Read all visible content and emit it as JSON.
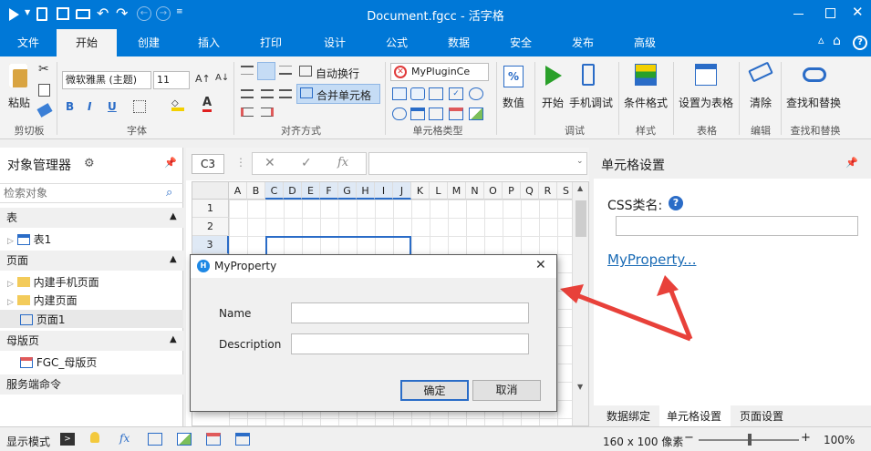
{
  "window": {
    "title": "Document.fgcc - 活字格"
  },
  "tabs": [
    "文件",
    "开始",
    "创建",
    "插入",
    "打印",
    "设计",
    "公式",
    "数据",
    "安全",
    "发布",
    "高级"
  ],
  "ribbon": {
    "paste": "粘贴",
    "clipboard": "剪切板",
    "font_name": "微软雅黑 (主题)",
    "font_size": "11",
    "bold": "B",
    "italic": "I",
    "underline": "U",
    "font_color_letter": "A",
    "font_group": "字体",
    "wrap_text": "自动换行",
    "merge_cells": "合并单元格",
    "align_group": "对齐方式",
    "celltype_combo": "MyPluginCe",
    "celltype_group": "单元格类型",
    "number_symbol": "%",
    "number": "数值",
    "start": "开始",
    "mobile_debug": "手机调试",
    "debug_group": "调试",
    "cond_format": "条件格式",
    "style_group": "样式",
    "set_table": "设置为表格",
    "table_group": "表格",
    "clear": "清除",
    "edit_group": "编辑",
    "find_replace": "查找和替换",
    "find_group": "查找和替换"
  },
  "object_manager": {
    "title": "对象管理器",
    "search_placeholder": "检索对象",
    "sections": {
      "table": "表",
      "page": "页面",
      "master": "母版页",
      "server_cmd": "服务端命令"
    },
    "items": {
      "table1": "表1",
      "builtin_mobile": "内建手机页面",
      "builtin_page": "内建页面",
      "page1": "页面1",
      "master_page": "FGC_母版页"
    }
  },
  "formula_bar": {
    "cell_ref": "C3",
    "fx": "fx",
    "cancel": "✕",
    "confirm": "✓"
  },
  "grid": {
    "columns": [
      "A",
      "B",
      "C",
      "D",
      "E",
      "F",
      "G",
      "H",
      "I",
      "J",
      "K",
      "L",
      "M",
      "N",
      "O",
      "P",
      "Q",
      "R",
      "S"
    ],
    "rows": [
      "1",
      "2",
      "3"
    ]
  },
  "cell_settings": {
    "title": "单元格设置",
    "css_label": "CSS类名:",
    "link": "MyProperty...",
    "tabs": [
      "数据绑定",
      "单元格设置",
      "页面设置"
    ]
  },
  "dialog": {
    "title": "MyProperty",
    "name_label": "Name",
    "description_label": "Description",
    "name_value": "",
    "description_value": "",
    "ok": "确定",
    "cancel": "取消"
  },
  "status": {
    "mode": "显示模式",
    "size": "160 x 100 像素",
    "zoom": "100%",
    "zoom_level": 1.0
  },
  "colors": {
    "brand": "#0078d7",
    "arrow": "#e8413a",
    "link": "#1a6bb5"
  }
}
